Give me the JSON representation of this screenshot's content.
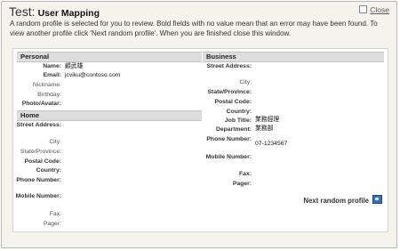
{
  "window": {
    "title_prefix": "Test:",
    "title": "User Mapping",
    "close_label": "Close",
    "intro": "A random profile is selected for you to review. Bold fields with no value mean that an error may have been found. To view another profile click 'Next random profile'. When you are finished close this window."
  },
  "personal": {
    "header": "Personal",
    "fields": [
      {
        "label": "Name:",
        "value": "顧武雄"
      },
      {
        "label": "Email:",
        "value": "jcviku@contoso.com"
      },
      {
        "label": "Nickname:",
        "value": ""
      },
      {
        "label": "Birthday:",
        "value": ""
      },
      {
        "label": "Photo/Avatar:",
        "value": ""
      }
    ]
  },
  "home": {
    "header": "Home",
    "fields": [
      {
        "label": "Street Address:",
        "value": ""
      },
      {
        "label": "City:",
        "value": ""
      },
      {
        "label": "State/Province:",
        "value": ""
      },
      {
        "label": "Postal Code:",
        "value": ""
      },
      {
        "label": "Country:",
        "value": ""
      },
      {
        "label": "Phone Number:",
        "value": ""
      },
      {
        "label": "Mobile Number:",
        "value": ""
      },
      {
        "label": "Fax:",
        "value": ""
      },
      {
        "label": "Pager:",
        "value": ""
      }
    ]
  },
  "business": {
    "header": "Business",
    "fields": [
      {
        "label": "Street Address:",
        "value": ""
      },
      {
        "label": "City:",
        "value": ""
      },
      {
        "label": "State/Province:",
        "value": ""
      },
      {
        "label": "Postal Code:",
        "value": ""
      },
      {
        "label": "Country:",
        "value": ""
      },
      {
        "label": "Job Title:",
        "value": "業務經理"
      },
      {
        "label": "Department:",
        "value": "業務部"
      },
      {
        "label": "Phone Number:",
        "value": "07-1234567"
      },
      {
        "label": "Mobile Number:",
        "value": ""
      },
      {
        "label": "Fax:",
        "value": ""
      },
      {
        "label": "Pager:",
        "value": ""
      }
    ]
  },
  "actions": {
    "next_label": "Next random profile",
    "next_icon": "next-page-icon"
  }
}
